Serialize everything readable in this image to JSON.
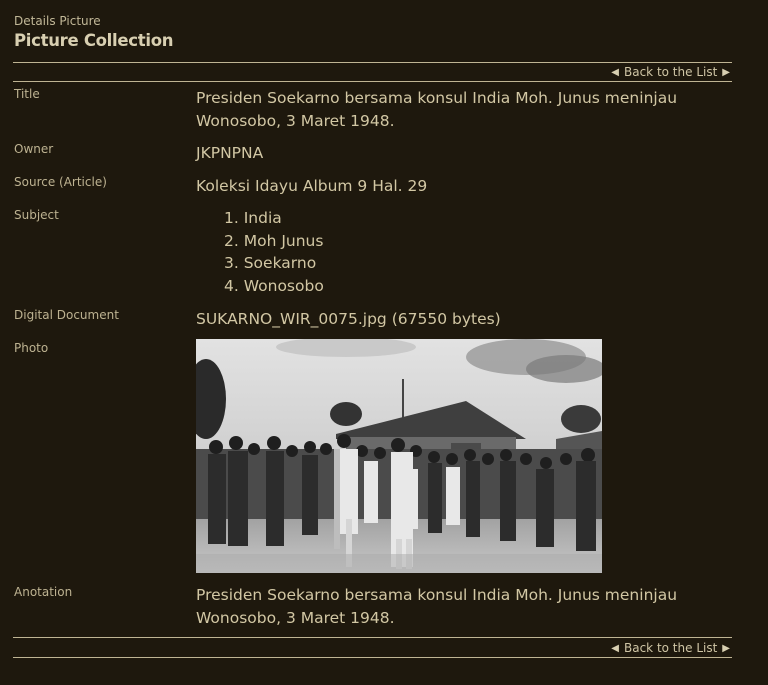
{
  "header": {
    "subtitle": "Details Picture",
    "title": "Picture Collection"
  },
  "nav": {
    "back_label": "Back to the List"
  },
  "fields": {
    "title": {
      "label": "Title",
      "value": "Presiden Soekarno bersama konsul India Moh. Junus meninjau Wonosobo, 3 Maret 1948."
    },
    "owner": {
      "label": "Owner",
      "value": "JKPNPNA"
    },
    "source": {
      "label": "Source (Article)",
      "value": "Koleksi Idayu Album 9 Hal. 29"
    },
    "subject": {
      "label": "Subject",
      "items": [
        "1. India",
        "2. Moh Junus",
        "3. Soekarno",
        "4. Wonosobo"
      ]
    },
    "digital_document": {
      "label": "Digital Document",
      "value": "SUKARNO_WIR_0075.jpg (67550 bytes)"
    },
    "photo": {
      "label": "Photo"
    },
    "anotation": {
      "label": "Anotation",
      "value": "Presiden Soekarno bersama konsul India Moh. Junus meninjau Wonosobo, 3 Maret 1948."
    }
  },
  "colors": {
    "background": "#1e180d",
    "text": "#d2c7a4",
    "rule": "#bfb493"
  }
}
